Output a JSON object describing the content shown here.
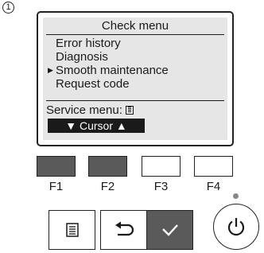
{
  "step": {
    "marker": "1"
  },
  "screen": {
    "title": "Check menu",
    "menu_items": [
      {
        "label": "Error history",
        "selected": false
      },
      {
        "label": "Diagnosis",
        "selected": false
      },
      {
        "label": "Smooth maintenance",
        "selected": true
      },
      {
        "label": "Request code",
        "selected": false
      }
    ],
    "selection_marker": "▶",
    "service_menu_label": "Service menu:",
    "cursor_hint": "▼ Cursor ▲"
  },
  "function_keys": [
    {
      "label": "F1",
      "active": true
    },
    {
      "label": "F2",
      "active": true
    },
    {
      "label": "F3",
      "active": false
    },
    {
      "label": "F4",
      "active": false
    }
  ],
  "buttons": {
    "menu_icon": "menu-icon",
    "back_icon": "return-icon",
    "confirm_icon": "check-icon",
    "power_icon": "power-icon"
  },
  "colors": {
    "key_active": "#5a5a5a",
    "lcd_background": "#e6e6e6",
    "indicator_led": "#888888"
  }
}
